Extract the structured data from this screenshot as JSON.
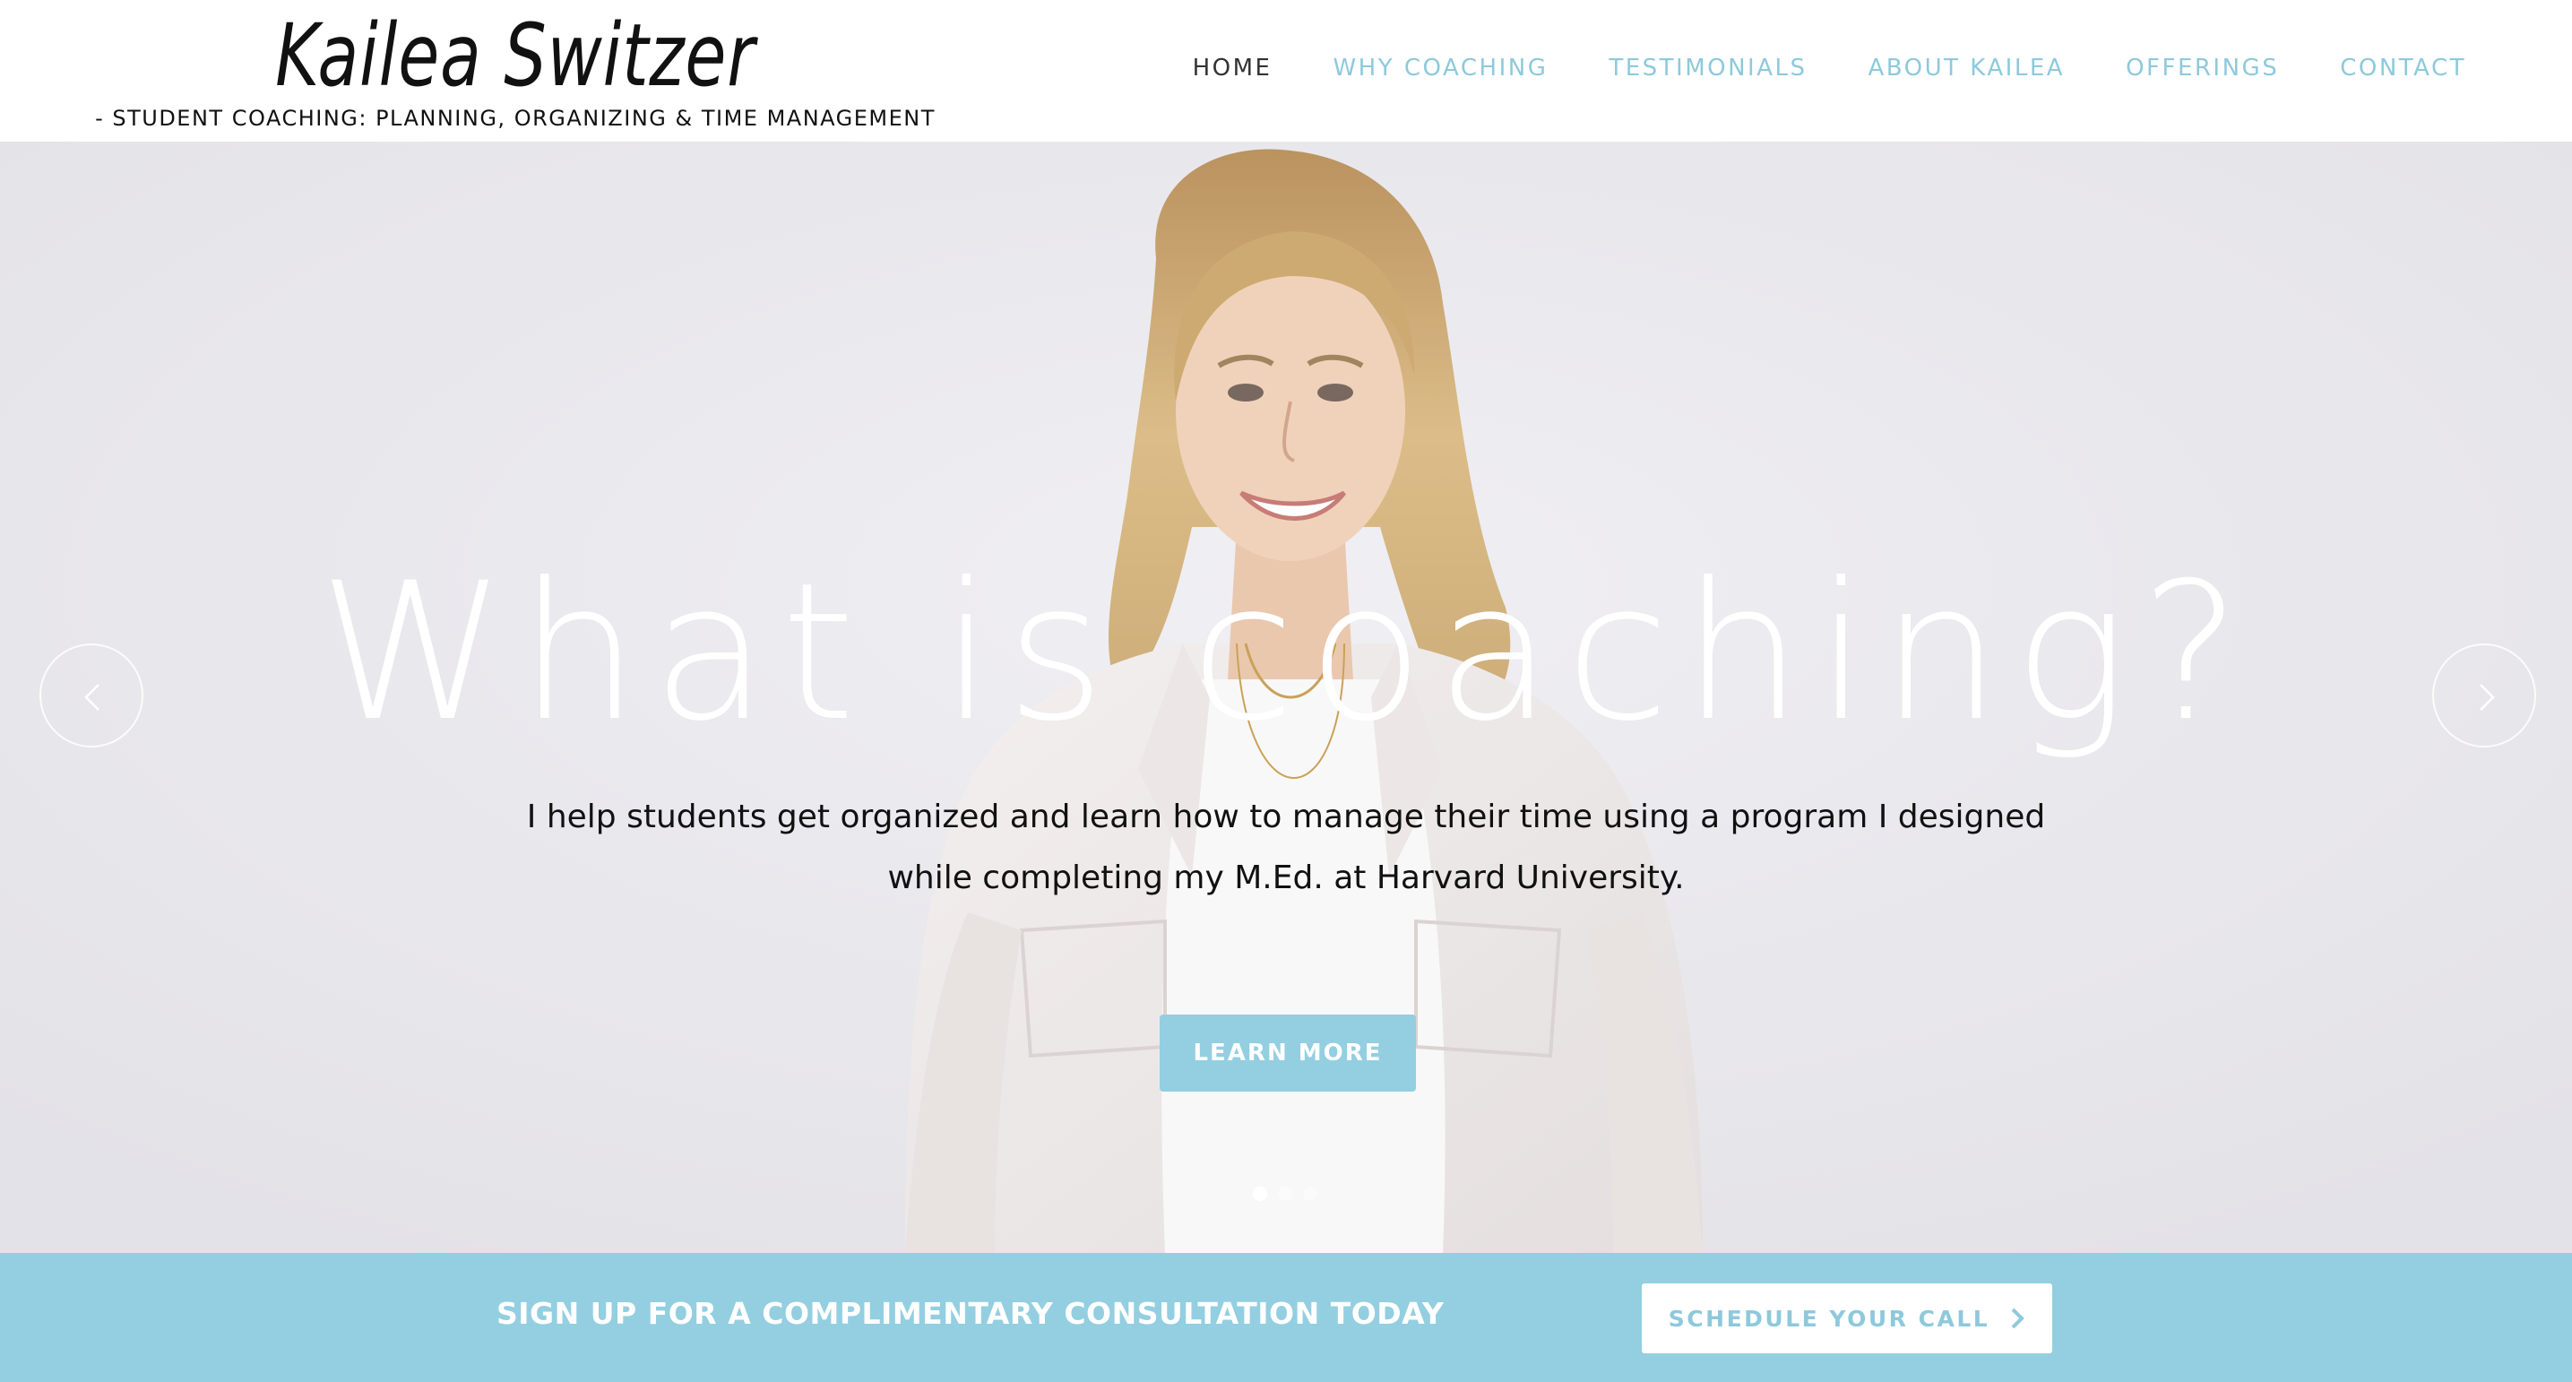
{
  "logo": {
    "name": "Kailea Switzer",
    "tagline": "- STUDENT COACHING: PLANNING, ORGANIZING & TIME MANAGEMENT -"
  },
  "nav": {
    "items": [
      {
        "label": "HOME",
        "active": true
      },
      {
        "label": "WHY COACHING",
        "active": false
      },
      {
        "label": "TESTIMONIALS",
        "active": false
      },
      {
        "label": "ABOUT KAILEA",
        "active": false
      },
      {
        "label": "OFFERINGS",
        "active": false
      },
      {
        "label": "CONTACT",
        "active": false
      }
    ]
  },
  "hero": {
    "title": "What is coaching?",
    "subtitle": "I help students get organized and learn how to manage their time using a program I designed while completing my M.Ed. at Harvard University.",
    "button_label": "LEARN MORE",
    "prev_icon": "chevron-left-icon",
    "next_icon": "chevron-right-icon",
    "slide_count": 3,
    "active_slide": 1
  },
  "cta": {
    "text": "SIGN UP FOR A COMPLIMENTARY CONSULTATION TODAY",
    "button_label": "SCHEDULE YOUR CALL",
    "button_icon": "chevron-right-icon"
  },
  "colors": {
    "accent": "#93cfe0",
    "nav_text": "#8ec9db",
    "active_nav": "#333333",
    "body_text": "#111111"
  }
}
